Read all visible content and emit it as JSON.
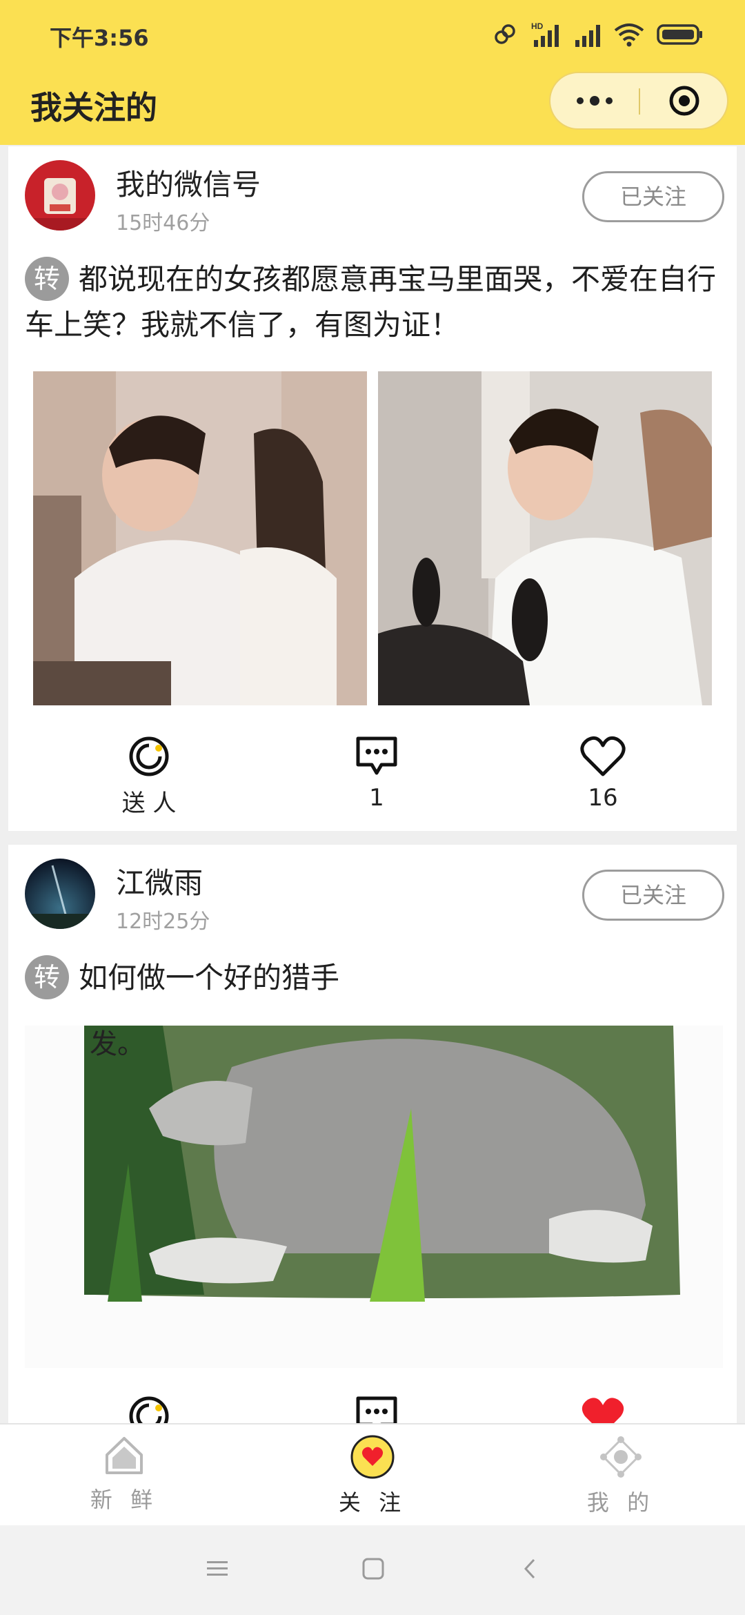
{
  "status_bar": {
    "time": "下午3:56",
    "network_badge": "HD"
  },
  "navbar": {
    "title": "我关注的"
  },
  "posts": [
    {
      "user": "我的微信号",
      "time": "15时46分",
      "follow_label": "已关注",
      "repost_badge": "转",
      "text": "都说现在的女孩都愿意再宝马里面哭，不爱在自行车上笑？我就不信了，有图为证！",
      "actions": {
        "gift_label": "送 人",
        "comment_count": "1",
        "like_count": "16"
      }
    },
    {
      "user": "江微雨",
      "time": "12时25分",
      "follow_label": "已关注",
      "repost_badge": "转",
      "text": "如何做一个好的猎手",
      "image_caption": "发。"
    }
  ],
  "tabbar": {
    "items": [
      {
        "label": "新 鲜",
        "icon": "home-icon",
        "active": false
      },
      {
        "label": "关 注",
        "icon": "heart-badge-icon",
        "active": true
      },
      {
        "label": "我 的",
        "icon": "network-icon",
        "active": false
      }
    ]
  },
  "colors": {
    "brand_yellow": "#fbe052",
    "like_red": "#f0202c",
    "muted_gray": "#9b9b9b"
  }
}
